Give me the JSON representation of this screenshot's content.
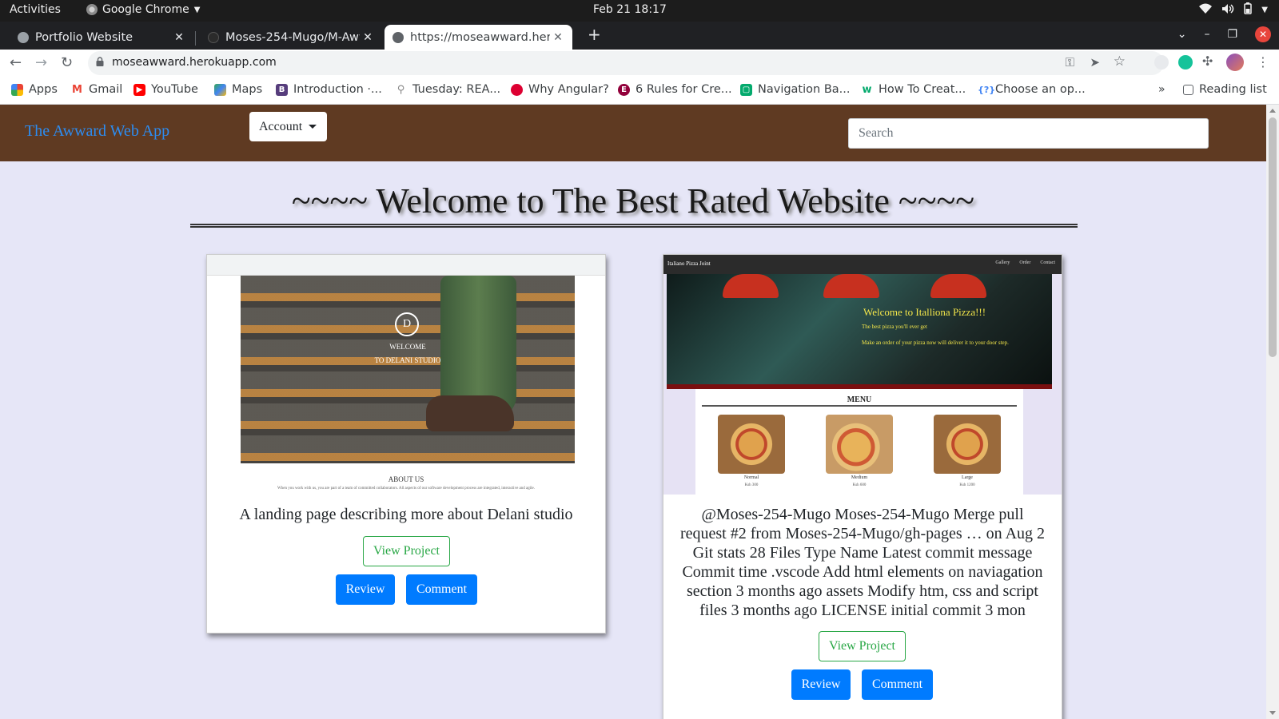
{
  "system": {
    "activities": "Activities",
    "app_name": "Google Chrome",
    "clock": "Feb 21  18:17"
  },
  "tabs": [
    {
      "title": "Portfolio Website",
      "active": false
    },
    {
      "title": "Moses-254-Mugo/M-Aww",
      "active": false
    },
    {
      "title": "https://moseawward.her",
      "active": true
    }
  ],
  "address": {
    "url": "moseawward.herokuapp.com"
  },
  "bookmarks": [
    {
      "label": "Apps",
      "icon": "apps-grid-icon"
    },
    {
      "label": "Gmail",
      "icon": "gmail-icon"
    },
    {
      "label": "YouTube",
      "icon": "youtube-icon"
    },
    {
      "label": "Maps",
      "icon": "maps-icon"
    },
    {
      "label": "Introduction ·...",
      "icon": "bootstrap-icon"
    },
    {
      "label": "Tuesday: REA...",
      "icon": "react-icon"
    },
    {
      "label": "Why Angular?",
      "icon": "angular-icon"
    },
    {
      "label": "6 Rules for Cre...",
      "icon": "elementor-icon"
    },
    {
      "label": "Navigation Ba...",
      "icon": "w3schools-icon"
    },
    {
      "label": "How To Creat...",
      "icon": "w3-icon"
    },
    {
      "label": "Choose an op...",
      "icon": "code-icon"
    }
  ],
  "reading_list": "Reading list",
  "page": {
    "brand": "The Awward Web App",
    "account_label": "Account",
    "search_placeholder": "Search",
    "headline": "~~~~ Welcome to The Best Rated Website ~~~~",
    "cards": [
      {
        "description": "A landing page describing more about Delani studio",
        "view_label": "View Project",
        "review_label": "Review",
        "comment_label": "Comment",
        "shot": {
          "welcome": "WELCOME",
          "studio": "TO DELANI STUDIO",
          "logo": "D",
          "about_title": "ABOUT US",
          "about_text": "When you work with us, you are part of a team of committed collaborators. All aspects of our software development process are integrated, interactive and agile."
        }
      },
      {
        "description": "@Moses-254-Mugo Moses-254-Mugo Merge pull request #2 from Moses-254-Mugo/gh-pages … on Aug 2 Git stats 28 Files Type Name Latest commit message Commit time .vscode Add html elements on naviagation section 3 months ago assets Modify htm, css and script files 3 months ago LICENSE initial commit 3 mon",
        "view_label": "View Project",
        "review_label": "Review",
        "comment_label": "Comment",
        "shot": {
          "site_title": "Italiano Pizza Joint",
          "nav_links": [
            "Gallery",
            "Order",
            "Contact"
          ],
          "hero_title": "Welcome to Italliona Pizza!!!",
          "hero_sub": "The best pizza you'll ever get",
          "hero_sub2": "Make an order of your pizza now will deliver it to your door step.",
          "menu_title": "MENU",
          "pizzas": [
            {
              "name": "Normal",
              "price": "Ksh 300"
            },
            {
              "name": "Medium",
              "price": "Ksh 600"
            },
            {
              "name": "Large",
              "price": "Ksh 1200"
            }
          ]
        }
      }
    ]
  },
  "colors": {
    "navbar_bg": "#5f3a22",
    "brand": "#2d8cf0",
    "primary": "#007bff",
    "success": "#28a745",
    "page_bg": "#e6e6f7"
  }
}
